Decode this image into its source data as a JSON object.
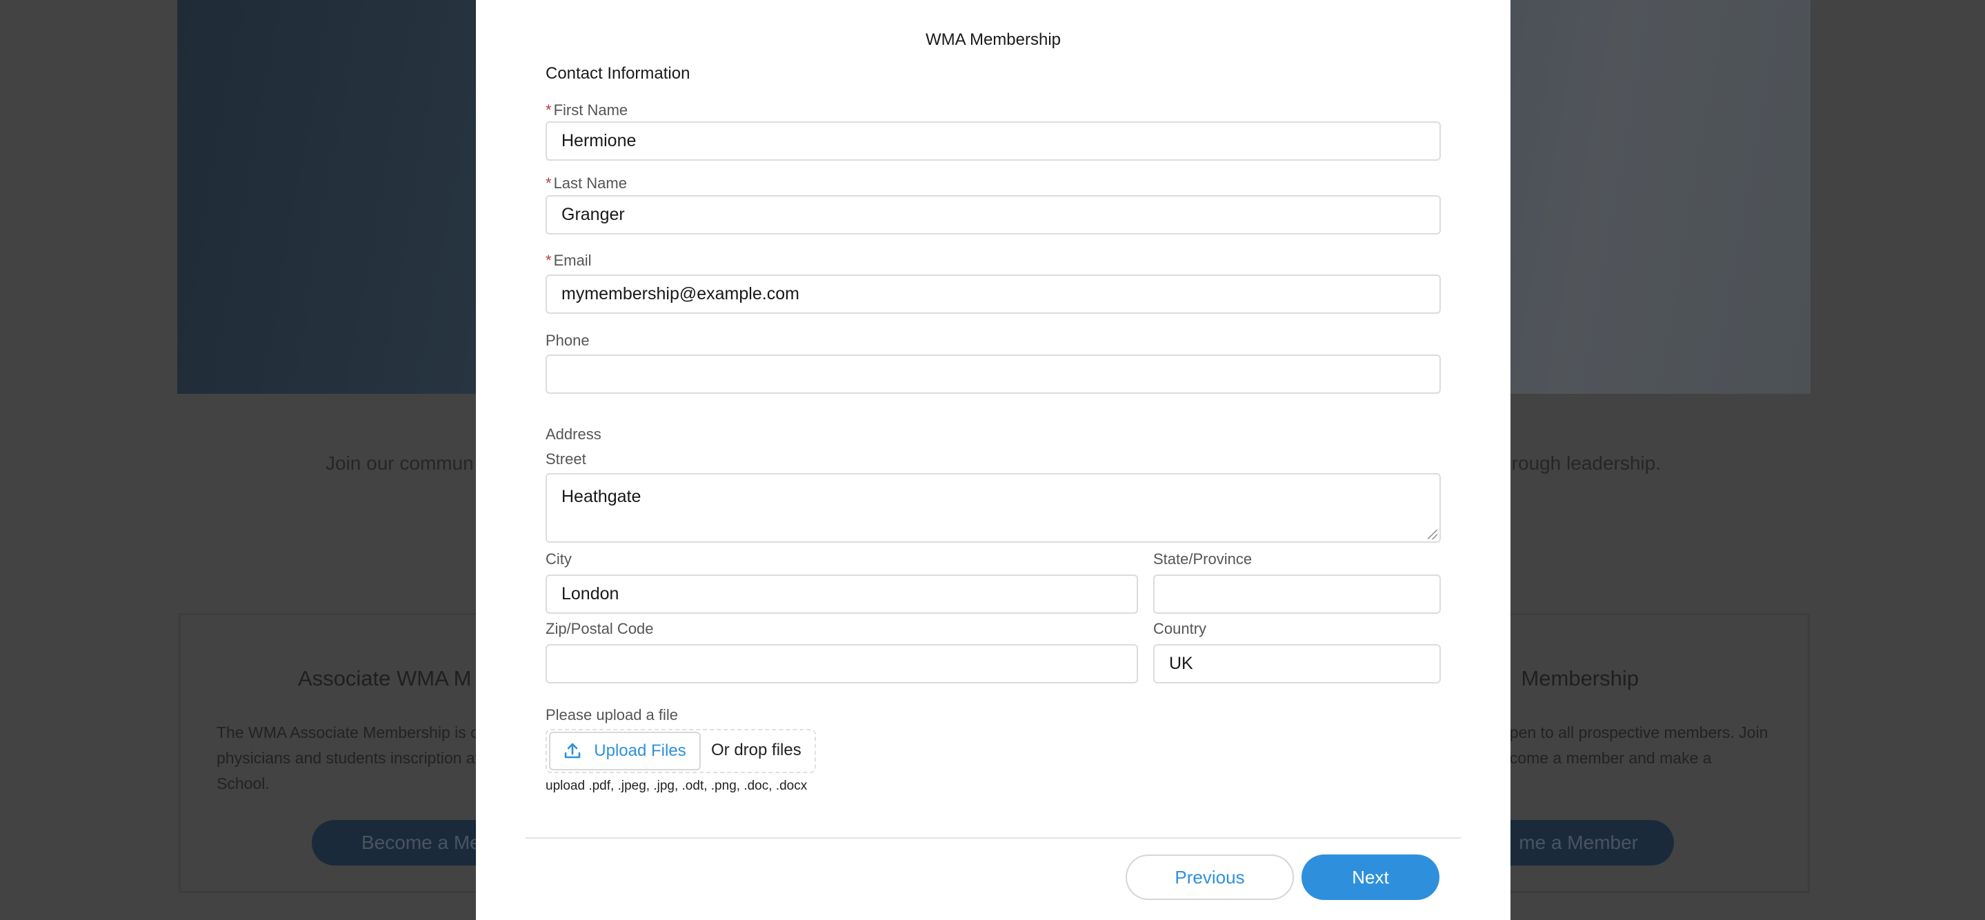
{
  "background": {
    "intro_left": "Join our commun",
    "intro_right": "rough leadership.",
    "card_left": {
      "heading": "Associate WMA M",
      "body": [
        "The WMA Associate Membership is o",
        "physicians and students inscription at",
        "School."
      ],
      "button": "Become a Mem"
    },
    "card_right": {
      "heading": "Membership",
      "body": [
        "open to all prospective members. Join",
        "ecome a member and make a"
      ],
      "button": "me a Member"
    }
  },
  "modal": {
    "title": "WMA Membership",
    "section": "Contact Information",
    "required_mark": "*",
    "fields": {
      "first_name": {
        "label": "First Name",
        "value": "Hermione",
        "required": true
      },
      "last_name": {
        "label": "Last Name",
        "value": "Granger",
        "required": true
      },
      "email": {
        "label": "Email",
        "value": "mymembership@example.com",
        "required": true
      },
      "phone": {
        "label": "Phone",
        "value": ""
      }
    },
    "address": {
      "heading": "Address",
      "street": {
        "label": "Street",
        "value": "Heathgate"
      },
      "city": {
        "label": "City",
        "value": "London"
      },
      "state": {
        "label": "State/Province",
        "value": ""
      },
      "zip": {
        "label": "Zip/Postal Code",
        "value": ""
      },
      "country": {
        "label": "Country",
        "value": "UK"
      }
    },
    "upload": {
      "label": "Please upload a file",
      "button": "Upload Files",
      "drop_text": "Or drop files",
      "hint": "upload .pdf, .jpeg, .jpg, .odt, .png, .doc, .docx",
      "icon": "upload-icon"
    },
    "footer": {
      "previous": "Previous",
      "next": "Next"
    }
  },
  "colors": {
    "accent": "#2e90dd",
    "required": "#c23934",
    "overlay": "#434343"
  }
}
